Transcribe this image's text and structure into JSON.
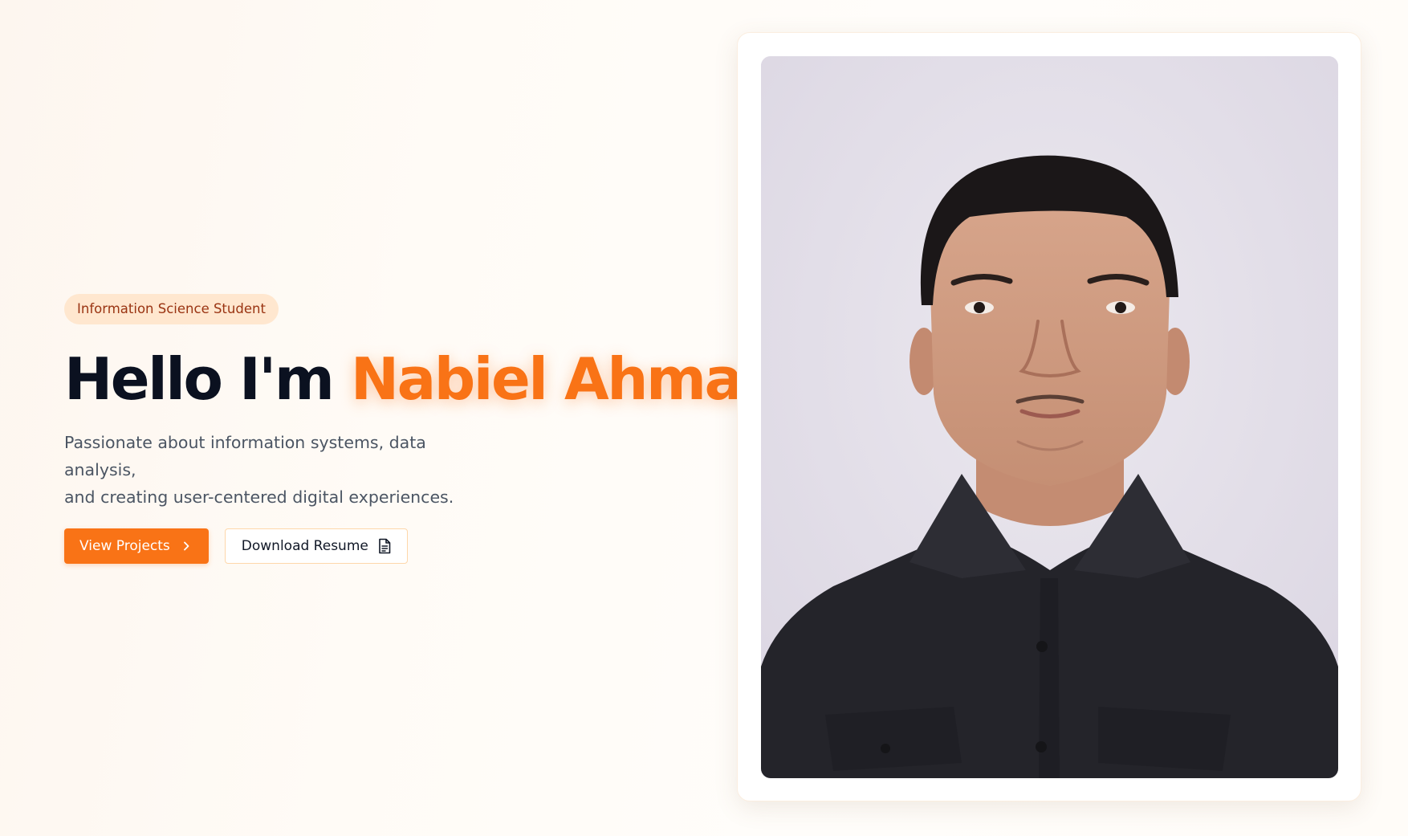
{
  "hero": {
    "badge": "Information Science Student",
    "headline_prefix": "Hello I'm ",
    "headline_name": "Nabiel Ahmad",
    "subtitle_line1": "Passionate about information systems, data analysis,",
    "subtitle_line2": "and creating user-centered digital experiences.",
    "primary_button": "View Projects",
    "secondary_button": "Download Resume"
  },
  "icons": {
    "primary_button_icon": "chevron-right-icon",
    "secondary_button_icon": "document-icon"
  },
  "colors": {
    "accent": "#f97316",
    "badge_bg": "#ffe7cf",
    "badge_text": "#9a3412",
    "headline": "#0b1120",
    "subtitle": "#4b5563",
    "photo_background": "#e2dde8",
    "shirt": "#24242a"
  }
}
